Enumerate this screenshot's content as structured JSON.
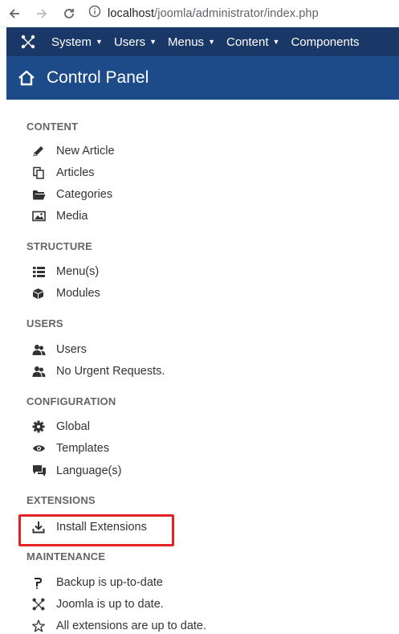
{
  "browser": {
    "url_host": "localhost",
    "url_path": "/joomla/administrator/index.php"
  },
  "topbar": {
    "menus": [
      {
        "label": "System"
      },
      {
        "label": "Users"
      },
      {
        "label": "Menus"
      },
      {
        "label": "Content"
      },
      {
        "label": "Components"
      }
    ]
  },
  "header": {
    "title": "Control Panel"
  },
  "sections": [
    {
      "title": "CONTENT",
      "items": [
        {
          "label": "New Article",
          "icon": "pencil-icon"
        },
        {
          "label": "Articles",
          "icon": "copy-icon"
        },
        {
          "label": "Categories",
          "icon": "folder-icon"
        },
        {
          "label": "Media",
          "icon": "picture-icon"
        }
      ]
    },
    {
      "title": "STRUCTURE",
      "items": [
        {
          "label": "Menu(s)",
          "icon": "list-icon"
        },
        {
          "label": "Modules",
          "icon": "cube-icon"
        }
      ]
    },
    {
      "title": "USERS",
      "items": [
        {
          "label": "Users",
          "icon": "users-icon"
        },
        {
          "label": "No Urgent Requests.",
          "icon": "users-icon"
        }
      ]
    },
    {
      "title": "CONFIGURATION",
      "items": [
        {
          "label": "Global",
          "icon": "cog-icon"
        },
        {
          "label": "Templates",
          "icon": "eye-icon"
        },
        {
          "label": "Language(s)",
          "icon": "comments-icon"
        }
      ]
    },
    {
      "title": "EXTENSIONS",
      "items": [
        {
          "label": "Install Extensions",
          "icon": "download-icon"
        }
      ]
    },
    {
      "title": "MAINTENANCE",
      "items": [
        {
          "label": "Backup is up-to-date",
          "icon": "akeeba-icon"
        },
        {
          "label": "Joomla is up to date.",
          "icon": "joomla-icon"
        },
        {
          "label": "All extensions are up to date.",
          "icon": "star-icon"
        }
      ]
    }
  ],
  "colors": {
    "topbar_bg": "#1a3867",
    "header_bg": "#1d4b8a",
    "highlight": "#e32222"
  }
}
